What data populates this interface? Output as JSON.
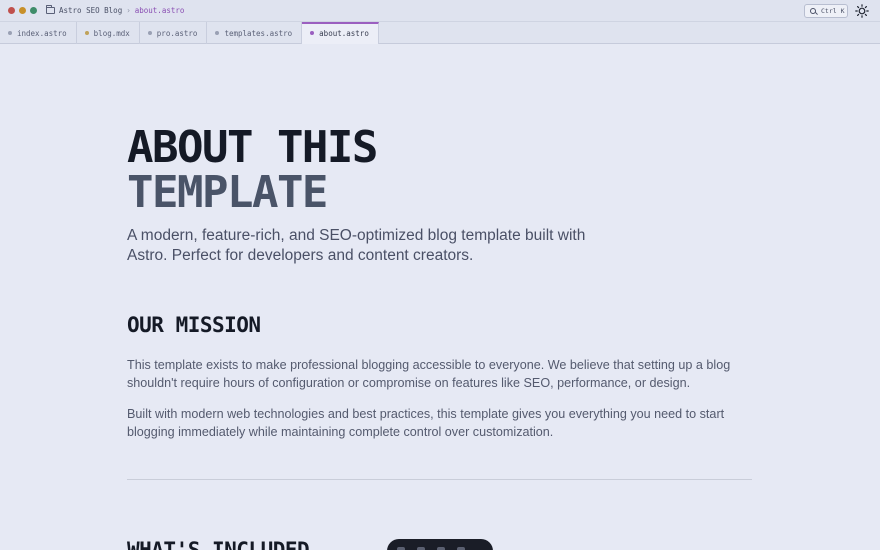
{
  "titlebar": {
    "project": "Astro SEO Blog",
    "separator": "›",
    "current_file": "about.astro",
    "search_label": "Ctrl K"
  },
  "tabs": [
    {
      "label": "index.astro",
      "active": false
    },
    {
      "label": "blog.mdx",
      "active": false
    },
    {
      "label": "pro.astro",
      "active": false
    },
    {
      "label": "templates.astro",
      "active": false
    },
    {
      "label": "about.astro",
      "active": true
    }
  ],
  "page": {
    "title_line1": "ABOUT THIS",
    "title_line2": "TEMPLATE",
    "lede": "A modern, feature-rich, and SEO-optimized blog template built with Astro. Perfect for developers and content creators.",
    "mission_heading": "OUR MISSION",
    "mission_p1": "This template exists to make professional blogging accessible to everyone. We believe that setting up a blog shouldn't require hours of configuration or compromise on features like SEO, performance, or design.",
    "mission_p2": "Built with modern web technologies and best practices, this template gives you everything you need to start blogging immediately while maintaining complete control over customization.",
    "included_heading": "WHAT'S INCLUDED"
  },
  "colors": {
    "background": "#e6e9f4",
    "accent": "#9b5fc0",
    "heading": "#151a26",
    "heading_secondary": "#4a5468"
  },
  "icons": {
    "folder": "folder-icon",
    "search": "search-icon",
    "theme": "sun-icon"
  }
}
